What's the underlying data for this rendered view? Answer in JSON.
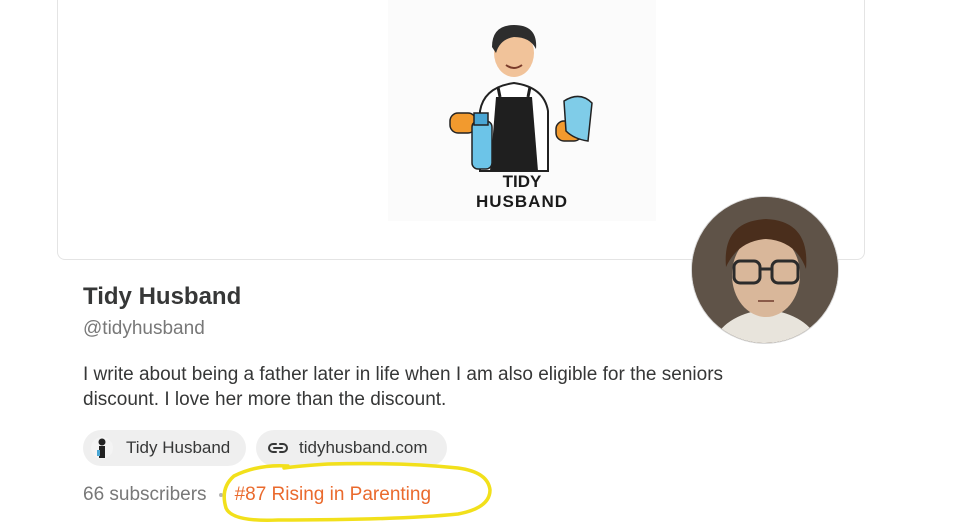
{
  "banner": {
    "logo_line1": "TIDY",
    "logo_line2": "HUSBAND",
    "logo_icon": "man-with-spray-bottle-and-cloth-logo"
  },
  "profile": {
    "name": "Tidy Husband",
    "handle": "@tidyhusband",
    "description": "I write about being a father later in life when I am also eligible for the seniors discount. I love her more than the discount.",
    "avatar_icon": "profile-photo-boy-with-glasses"
  },
  "chips": {
    "author_label": "Tidy Husband",
    "link_label": "tidyhusband.com",
    "link_icon": "link-icon"
  },
  "stats": {
    "subscribers": "66 subscribers",
    "rising": "#87 Rising in Parenting"
  },
  "colors": {
    "accent_orange": "#ea6a2d",
    "highlight_yellow": "#f2e01b",
    "chip_bg": "#efefef"
  }
}
